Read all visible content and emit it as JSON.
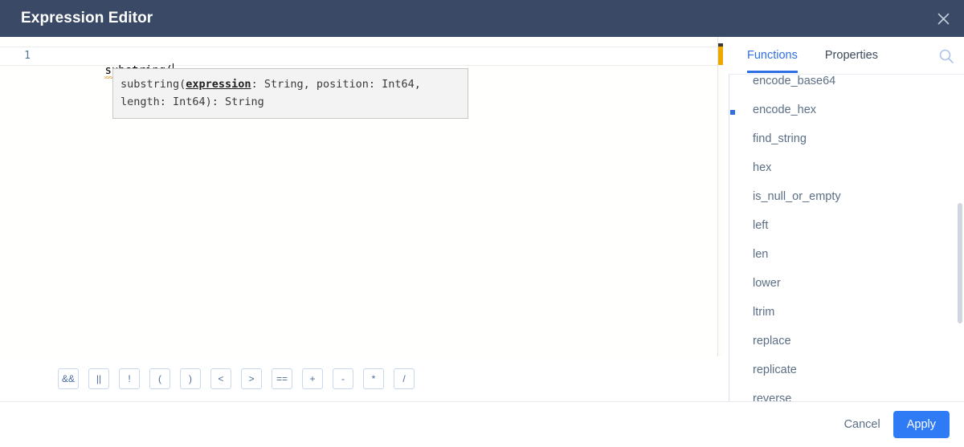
{
  "header": {
    "title": "Expression Editor",
    "close_icon": "close-icon"
  },
  "editor": {
    "line_number": "1",
    "code_warn_token": "substring(",
    "signature": {
      "prefix": "substring(",
      "active_param": "expression",
      "suffix": ": String, position: Int64, length: Int64): String"
    }
  },
  "operators": [
    {
      "label": "&&",
      "name": "operator-and"
    },
    {
      "label": "||",
      "name": "operator-or"
    },
    {
      "label": "!",
      "name": "operator-not"
    },
    {
      "label": "(",
      "name": "operator-paren-open"
    },
    {
      "label": ")",
      "name": "operator-paren-close"
    },
    {
      "label": "<",
      "name": "operator-less-than"
    },
    {
      "label": ">",
      "name": "operator-greater-than"
    },
    {
      "label": "==",
      "name": "operator-equals"
    },
    {
      "label": "+",
      "name": "operator-plus"
    },
    {
      "label": "-",
      "name": "operator-minus"
    },
    {
      "label": "*",
      "name": "operator-multiply"
    },
    {
      "label": "/",
      "name": "operator-divide"
    }
  ],
  "panel": {
    "tabs": [
      {
        "label": "Functions",
        "active": true
      },
      {
        "label": "Properties",
        "active": false
      }
    ],
    "search_icon": "search-icon",
    "functions": [
      "encode_base64",
      "encode_hex",
      "find_string",
      "hex",
      "is_null_or_empty",
      "left",
      "len",
      "lower",
      "ltrim",
      "replace",
      "replicate",
      "reverse"
    ]
  },
  "footer": {
    "cancel_label": "Cancel",
    "apply_label": "Apply"
  },
  "colors": {
    "header_bg": "#3a4a66",
    "accent_blue": "#2f7bf6",
    "tab_active": "#2f6fe4",
    "warning_amber": "#eda900"
  }
}
